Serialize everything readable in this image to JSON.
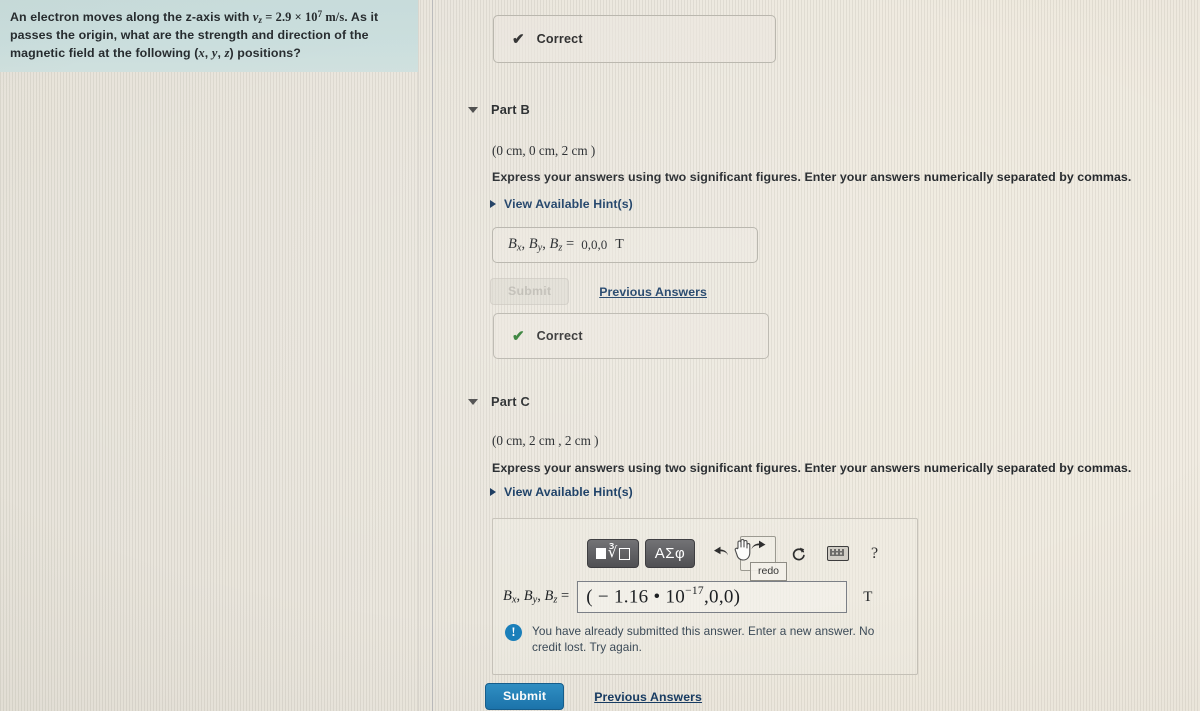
{
  "question": {
    "text_line1_pre": "An electron moves along the z-axis with ",
    "velocity_symbol": "v",
    "velocity_sub": "z",
    "velocity_eq": " = ",
    "velocity_value": "2.9 × 10",
    "velocity_exp": "7",
    "velocity_unit": " m/s",
    "text_after": ". As it passes the origin, what are the strength and direction of the magnetic field at the following (",
    "coord_x": "x",
    "coord_y": "y",
    "coord_z": "z",
    "text_end": ") positions?",
    "full_text": "An electron moves along the z-axis with v_z = 2.9 × 10^7 m/s. As it passes the origin, what are the strength and direction of the magnetic field at the following (x, y, z) positions?"
  },
  "feedback": {
    "correct_a_label": "Correct",
    "correct_a_icon": "check-icon",
    "correct_b_label": "Correct",
    "correct_b_icon": "check-icon",
    "correct_color": "#2f7d32"
  },
  "part_b": {
    "title": "Part B",
    "collapse_icon": "triangle-down-icon",
    "coordinates": "(0 cm, 0 cm, 2 cm )",
    "instructions": "Express your answers using two significant figures. Enter your answers numerically separated by commas.",
    "hint_label": "View Available Hint(s)",
    "hint_icon": "triangle-right-icon",
    "answer_label_x": "B",
    "answer_label_sub_x": "x",
    "answer_label_y": "B",
    "answer_label_sub_y": "y",
    "answer_label_z": "B",
    "answer_label_sub_z": "z",
    "answer_equals": "=",
    "answer_value": "0,0,0",
    "answer_unit": "T",
    "submit_label": "Submit",
    "submit_disabled": true,
    "previous_answers_label": "Previous Answers"
  },
  "part_c": {
    "title": "Part C",
    "collapse_icon": "triangle-down-icon",
    "coordinates": "(0 cm, 2 cm , 2 cm )",
    "instructions": "Express your answers using two significant figures. Enter your answers numerically separated by commas.",
    "hint_label": "View Available Hint(s)",
    "hint_icon": "triangle-right-icon",
    "toolbar": {
      "template_button_icon": "math-template-icon",
      "greek_button_label": "ΑΣφ",
      "undo_icon": "undo-arrow-icon",
      "redo_icon": "redo-arrow-icon",
      "redo_tooltip": "redo",
      "reset_icon": "reset-circular-arrow-icon",
      "keyboard_icon": "keyboard-icon",
      "help_label": "?"
    },
    "answer_label": "B",
    "answer_sub_x": "x",
    "answer_sub_y": "y",
    "answer_sub_z": "z",
    "answer_equals": "=",
    "answer_value_prefix": "( − 1.16 • 10",
    "answer_value_exp": "−17",
    "answer_value_suffix": ",0,0)",
    "answer_unit": "T",
    "warning_icon": "exclamation-circle-icon",
    "warning_text": "You have already submitted this answer. Enter a new answer. No credit lost. Try again.",
    "warning_color": "#1a7fba",
    "submit_label": "Submit",
    "previous_answers_label": "Previous Answers"
  }
}
